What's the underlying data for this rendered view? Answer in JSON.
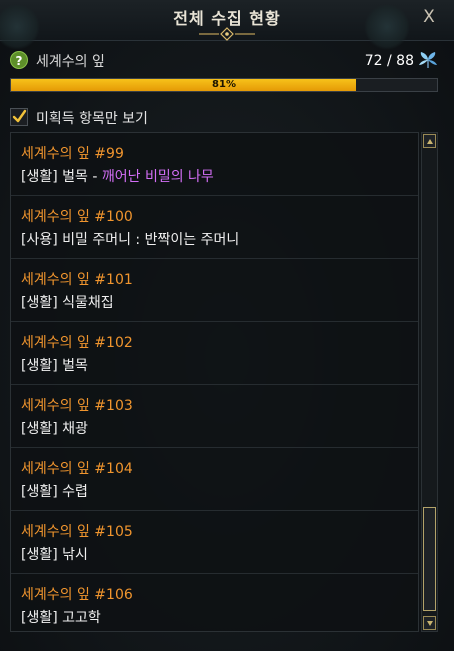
{
  "window": {
    "title": "전체 수집 현황",
    "close_label": "X"
  },
  "summary": {
    "collection_name": "세계수의 잎",
    "count": "72 / 88",
    "progress_label": "81%",
    "progress_value": 0.81
  },
  "filter": {
    "label": "미획득 항목만 보기",
    "checked": true
  },
  "items": [
    {
      "title": "세계수의 잎 #99",
      "desc": "[생활] 벌목 - ",
      "highlight": "깨어난 비밀의 나무"
    },
    {
      "title": "세계수의 잎 #100",
      "desc": "[사용] 비밀 주머니 : 반짝이는 주머니",
      "highlight": ""
    },
    {
      "title": "세계수의 잎 #101",
      "desc": "[생활] 식물채집",
      "highlight": ""
    },
    {
      "title": "세계수의 잎 #102",
      "desc": "[생활] 벌목",
      "highlight": ""
    },
    {
      "title": "세계수의 잎 #103",
      "desc": "[생활] 채광",
      "highlight": ""
    },
    {
      "title": "세계수의 잎 #104",
      "desc": "[생활] 수렵",
      "highlight": ""
    },
    {
      "title": "세계수의 잎 #105",
      "desc": "[생활] 낚시",
      "highlight": ""
    },
    {
      "title": "세계수의 잎 #106",
      "desc": "[생활] 고고학",
      "highlight": ""
    }
  ],
  "colors": {
    "item_title": "#f0952e",
    "highlight": "#d36ef6",
    "progress_fill": "#f7c21a"
  }
}
